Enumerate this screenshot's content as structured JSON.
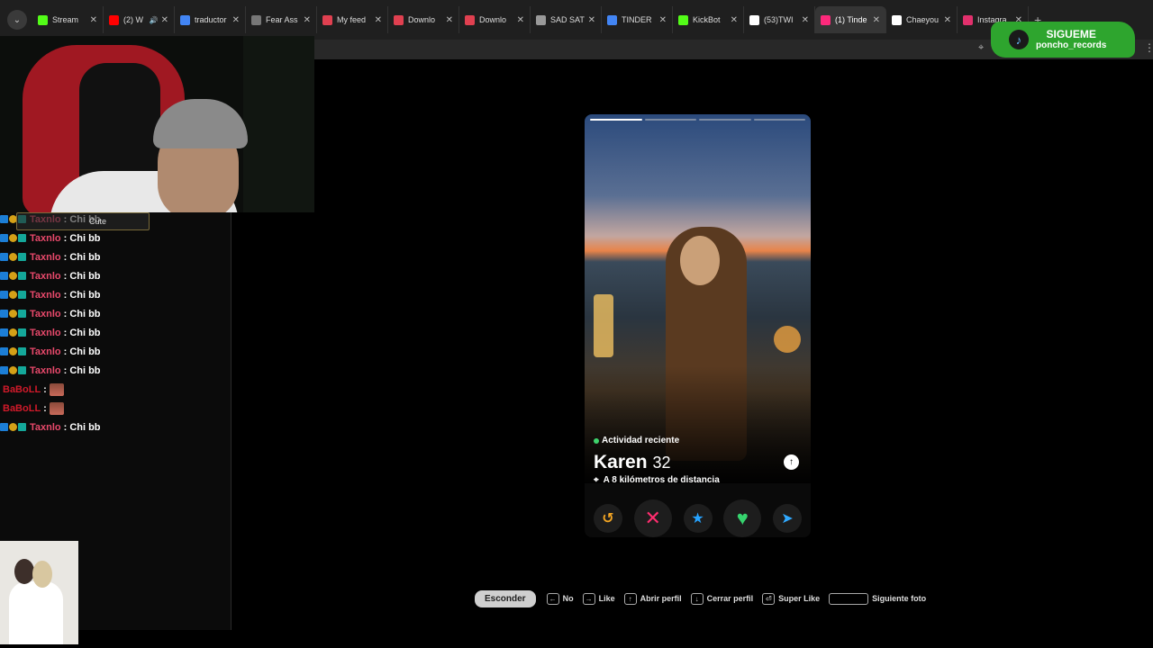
{
  "browser": {
    "tabs": [
      {
        "label": "Stream",
        "favicon_color": "#53fc18",
        "active": false
      },
      {
        "label": "(2) W",
        "favicon_color": "#ff0000",
        "active": false,
        "audio": true
      },
      {
        "label": "traductor",
        "favicon_color": "#4285f4",
        "active": false
      },
      {
        "label": "Fear Ass",
        "favicon_color": "#777777",
        "active": false
      },
      {
        "label": "My feed",
        "favicon_color": "#e04050",
        "active": false
      },
      {
        "label": "Downlo",
        "favicon_color": "#e04050",
        "active": false
      },
      {
        "label": "Downlo",
        "favicon_color": "#e04050",
        "active": false
      },
      {
        "label": "SAD SAT",
        "favicon_color": "#999999",
        "active": false
      },
      {
        "label": "TINDER",
        "favicon_color": "#4285f4",
        "active": false
      },
      {
        "label": "KickBot",
        "favicon_color": "#53fc18",
        "active": false
      },
      {
        "label": "(53)TWI",
        "favicon_color": "#ffffff",
        "active": false
      },
      {
        "label": "(1) Tinde",
        "favicon_color": "#fd297b",
        "active": true
      },
      {
        "label": "Chaeyou",
        "favicon_color": "#ffffff",
        "active": false
      },
      {
        "label": "Instagra",
        "favicon_color": "#e1306c",
        "active": false
      }
    ],
    "new_tab": "+",
    "close_glyph": "✕"
  },
  "overlay_badge": {
    "line1": "SIGUEME",
    "line2": "poncho_records"
  },
  "chat": {
    "messages": [
      {
        "user": "Taxnlo",
        "text": "Chi bb",
        "color": "#e8496b",
        "badges": true
      },
      {
        "user": "Taxnlo",
        "text": "Chi bb",
        "color": "#e8496b",
        "badges": true
      },
      {
        "user": "Taxnlo",
        "text": "Chi bb",
        "color": "#e8496b",
        "badges": true
      },
      {
        "user": "Taxnlo",
        "text": "Chi bb",
        "color": "#e8496b",
        "badges": true
      },
      {
        "user": "Taxnlo",
        "text": "Chi bb",
        "color": "#e8496b",
        "badges": true
      },
      {
        "user": "Taxnlo",
        "text": "Chi bb",
        "color": "#e8496b",
        "badges": true
      },
      {
        "user": "Taxnlo",
        "text": "Chi bb",
        "color": "#e8496b",
        "badges": true
      },
      {
        "user": "Taxnlo",
        "text": "Chi bb",
        "color": "#e8496b",
        "badges": true
      },
      {
        "user": "Taxnlo",
        "text": "Chi bb",
        "color": "#e8496b",
        "badges": true
      },
      {
        "user": "BaBoLL",
        "text": "",
        "color": "#d11a2a",
        "badges": false,
        "emote": true
      },
      {
        "user": "BaBoLL",
        "text": "",
        "color": "#d11a2a",
        "badges": false,
        "emote": true
      },
      {
        "user": "Taxnlo",
        "text": "Chi bb",
        "color": "#e8496b",
        "badges": true
      }
    ],
    "separator": ":",
    "emote_tooltip": "Cute"
  },
  "profile": {
    "activity": "Actividad reciente",
    "name": "Karen",
    "age": "32",
    "distance": "A 8 kilómetros de distancia",
    "photo_count": 4,
    "current_photo": 1,
    "info_icon": "arrow-up-icon"
  },
  "actions": [
    {
      "name": "rewind",
      "glyph": "↺"
    },
    {
      "name": "nope",
      "glyph": "✕"
    },
    {
      "name": "super-like",
      "glyph": "★"
    },
    {
      "name": "like",
      "glyph": "♥"
    },
    {
      "name": "boost",
      "glyph": "➤"
    }
  ],
  "shortcuts": {
    "hide_label": "Esconder",
    "items": [
      {
        "key": "←",
        "label": "No"
      },
      {
        "key": "→",
        "label": "Like"
      },
      {
        "key": "↑",
        "label": "Abrir perfil"
      },
      {
        "key": "↓",
        "label": "Cerrar perfil"
      },
      {
        "key": "⏎",
        "label": "Super Like"
      },
      {
        "key": "",
        "label": "Siguiente foto",
        "wide": true
      }
    ]
  },
  "colors": {
    "tinder_pink": "#fd297b",
    "online_green": "#3ed36c",
    "badge_green": "#2ea52e"
  }
}
